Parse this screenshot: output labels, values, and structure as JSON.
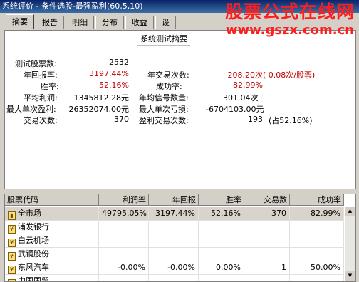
{
  "window": {
    "title": "系统评价 - 条件选股-最强盈利(60,5,10)"
  },
  "watermark": {
    "line1": "股票公式在线网",
    "line2": "www.gszx.com.cn"
  },
  "tabs": [
    {
      "label": "摘要",
      "active": true
    },
    {
      "label": "报告",
      "active": false
    },
    {
      "label": "明细",
      "active": false
    },
    {
      "label": "分布",
      "active": false
    },
    {
      "label": "收益",
      "active": false
    },
    {
      "label": "设",
      "active": false
    }
  ],
  "summary": {
    "title": "系统测试摘要",
    "test_stock_count_label": "测试股票数:",
    "test_stock_count": "2532",
    "annual_return_label": "年回报率:",
    "annual_return": "3197.44%",
    "annual_trades_label": "年交易次数:",
    "annual_trades": "208.20次",
    "annual_trades_per_stock": "( 0.08次/股票)",
    "win_rate_label": "胜率:",
    "win_rate": "52.16%",
    "success_rate_label": "成功率:",
    "success_rate": "82.99%",
    "avg_profit_label": "平均利润:",
    "avg_profit": "1345812.28元",
    "annual_signals_label": "年均信号数量:",
    "annual_signals": "301.04次",
    "max_single_profit_label": "最大单次盈利:",
    "max_single_profit": "26352074.00元",
    "max_single_loss_label": "最大单次亏损:",
    "max_single_loss": "-6704103.00元",
    "trade_count_label": "交易次数:",
    "trade_count": "370",
    "profit_trades_label": "盈利交易次数:",
    "profit_trades": "193",
    "profit_trades_share": "(占52.16%)"
  },
  "grid": {
    "headers": [
      "股票代码",
      "利润率",
      "年回报",
      "胜率",
      "交易数",
      "成功率"
    ],
    "rows": [
      {
        "name": "全市场",
        "profit": "49795.05%",
        "annual": "3197.44%",
        "win": "52.16%",
        "trades": "370",
        "success": "82.99%"
      },
      {
        "name": "浦发银行",
        "profit": "",
        "annual": "",
        "win": "",
        "trades": "",
        "success": ""
      },
      {
        "name": "白云机场",
        "profit": "",
        "annual": "",
        "win": "",
        "trades": "",
        "success": ""
      },
      {
        "name": "武钢股份",
        "profit": "",
        "annual": "",
        "win": "",
        "trades": "",
        "success": ""
      },
      {
        "name": "东风汽车",
        "profit": "-0.00%",
        "annual": "-0.00%",
        "win": "0.00%",
        "trades": "1",
        "success": "50.00%"
      },
      {
        "name": "中国国贸",
        "profit": "",
        "annual": "",
        "win": "",
        "trades": "",
        "success": ""
      }
    ]
  },
  "scrollbar": {
    "up_icon": "▲",
    "down_icon": "▼"
  }
}
